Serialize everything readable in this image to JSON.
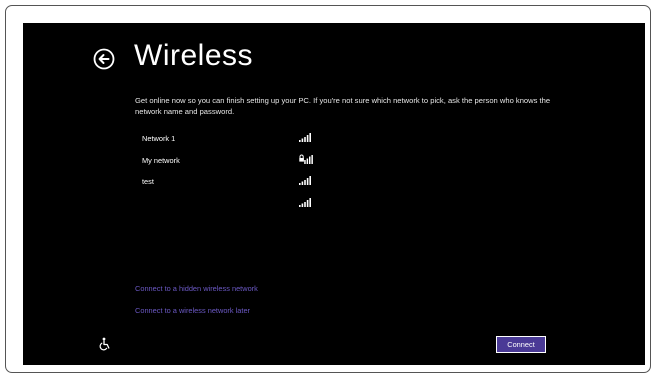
{
  "page": {
    "title": "Wireless",
    "description": "Get online now so you can finish setting up your PC. If you're not sure which network to pick, ask the person who knows the network name and password."
  },
  "networks": [
    {
      "name": "Network 1",
      "secured": false
    },
    {
      "name": "My network",
      "secured": true
    },
    {
      "name": "test",
      "secured": false
    },
    {
      "name": "",
      "secured": false
    }
  ],
  "links": {
    "hidden_network": "Connect to a hidden wireless network",
    "later": "Connect to a wireless network later"
  },
  "buttons": {
    "connect": "Connect"
  },
  "colors": {
    "background": "#000000",
    "accent": "#4a3a96",
    "link": "#6b59c4",
    "text": "#ffffff"
  },
  "icons": {
    "back": "back-arrow-circle-icon",
    "signal": "wifi-signal-icon",
    "lock": "lock-icon",
    "ease_of_access": "ease-of-access-icon"
  }
}
